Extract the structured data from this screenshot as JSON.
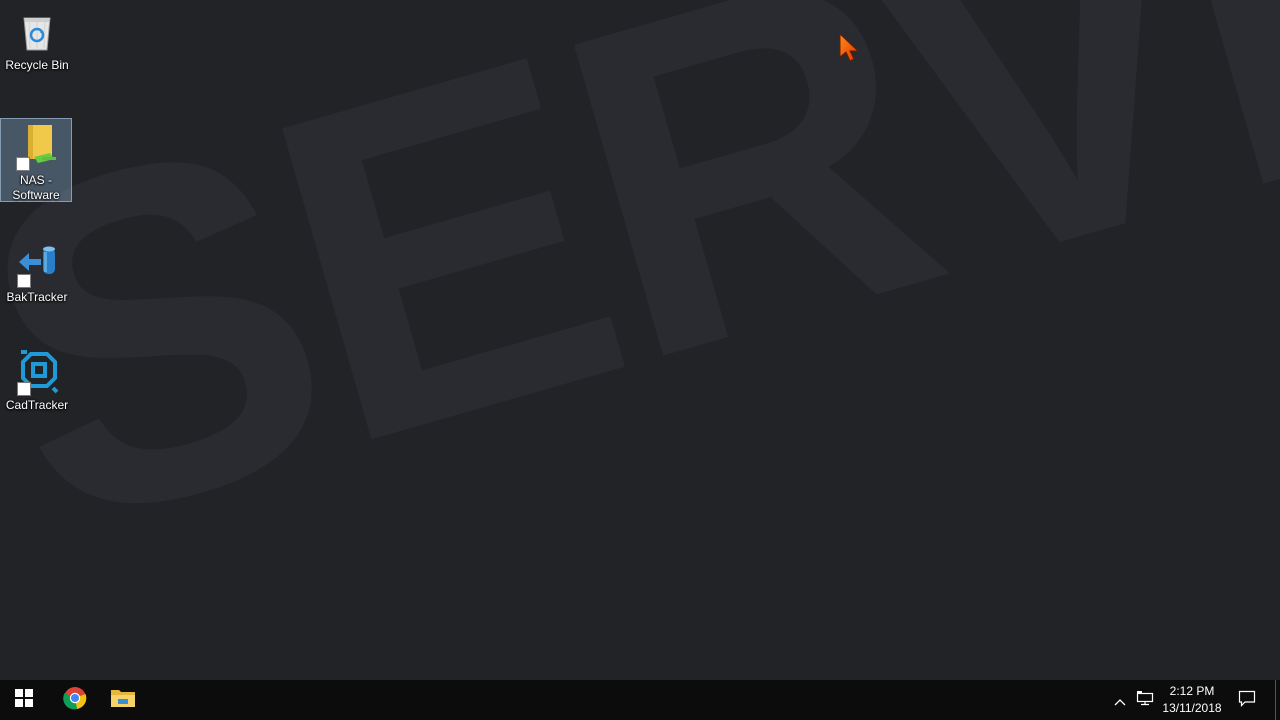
{
  "wallpaper": {
    "text": "SERVER"
  },
  "desktop_icons": [
    {
      "label": "Recycle Bin",
      "icon": "recycle-bin-icon",
      "selected": false
    },
    {
      "label": "NAS - Software",
      "icon": "folder-network-shortcut-icon",
      "selected": true
    },
    {
      "label": "BakTracker",
      "icon": "baktracker-shortcut-icon",
      "selected": false
    },
    {
      "label": "CadTracker",
      "icon": "cadtracker-shortcut-icon",
      "selected": false
    }
  ],
  "taskbar": {
    "start_icon": "windows-logo-icon",
    "pinned": [
      {
        "name": "Google Chrome",
        "icon": "chrome-icon"
      },
      {
        "name": "File Explorer",
        "icon": "file-explorer-icon"
      }
    ],
    "tray": {
      "overflow_icon": "chevron-up-icon",
      "network_icon": "network-icon",
      "time": "2:12 PM",
      "date": "13/11/2018",
      "notification_icon": "action-center-icon"
    }
  },
  "colors": {
    "desktop_bg": "#222327",
    "taskbar_bg": "#0c0c0c",
    "cadtracker_accent": "#1e9bd7",
    "folder_yellow": "#f0c84a"
  }
}
